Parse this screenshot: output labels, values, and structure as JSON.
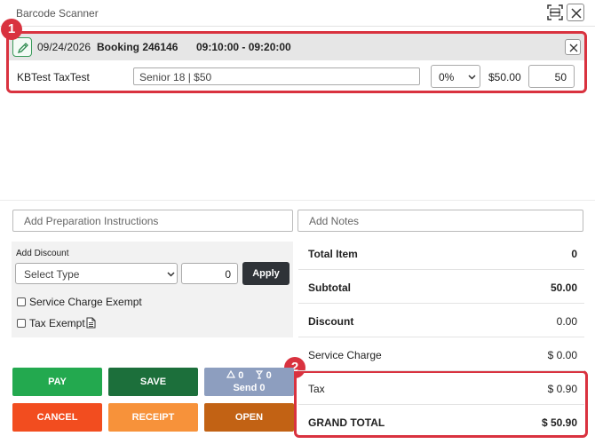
{
  "window": {
    "title": "Barcode Scanner"
  },
  "booking": {
    "date": "09/24/2026",
    "number": "Booking 246146",
    "time": "09:10:00 - 09:20:00",
    "customer": "KBTest TaxTest",
    "ticket": "Senior 18 | $50",
    "discount_percent": "0%",
    "price": "$50.00",
    "quantity": "50"
  },
  "callouts": [
    "1",
    "2"
  ],
  "inputs": {
    "prep_placeholder": "Add Preparation Instructions",
    "notes_placeholder": "Add Notes"
  },
  "discount": {
    "label": "Add Discount",
    "type_placeholder": "Select Type",
    "amount": "0",
    "apply_label": "Apply",
    "service_charge_exempt": "Service Charge Exempt",
    "tax_exempt": "Tax Exempt"
  },
  "summary": {
    "total_item_label": "Total Item",
    "total_item": "0",
    "subtotal_label": "Subtotal",
    "subtotal": "50.00",
    "discount_label": "Discount",
    "discount": "0.00",
    "service_charge_label": "Service Charge",
    "service_charge": "$ 0.00",
    "tax_label": "Tax",
    "tax": "$ 0.90",
    "grand_total_label": "GRAND TOTAL",
    "grand_total": "$ 50.90"
  },
  "actions": {
    "pay": "PAY",
    "save": "SAVE",
    "send_count_a": "0",
    "send_count_b": "0",
    "send": "Send 0",
    "cancel": "CANCEL",
    "receipt": "RECEIPT",
    "open": "OPEN"
  },
  "colors": {
    "callout": "#d9323f",
    "pay": "#23a94f",
    "save": "#1c6f3b",
    "send": "#8d9ebf",
    "cancel": "#f24d1f",
    "receipt": "#f7923a",
    "open": "#c26214",
    "apply": "#2f3338"
  },
  "icons": {
    "scan": "barcode-scan-icon",
    "close": "close-icon",
    "edit": "pencil-icon",
    "chevron": "chevron-down-icon",
    "document": "document-icon",
    "bell": "bell-icon",
    "cup": "cup-icon"
  }
}
